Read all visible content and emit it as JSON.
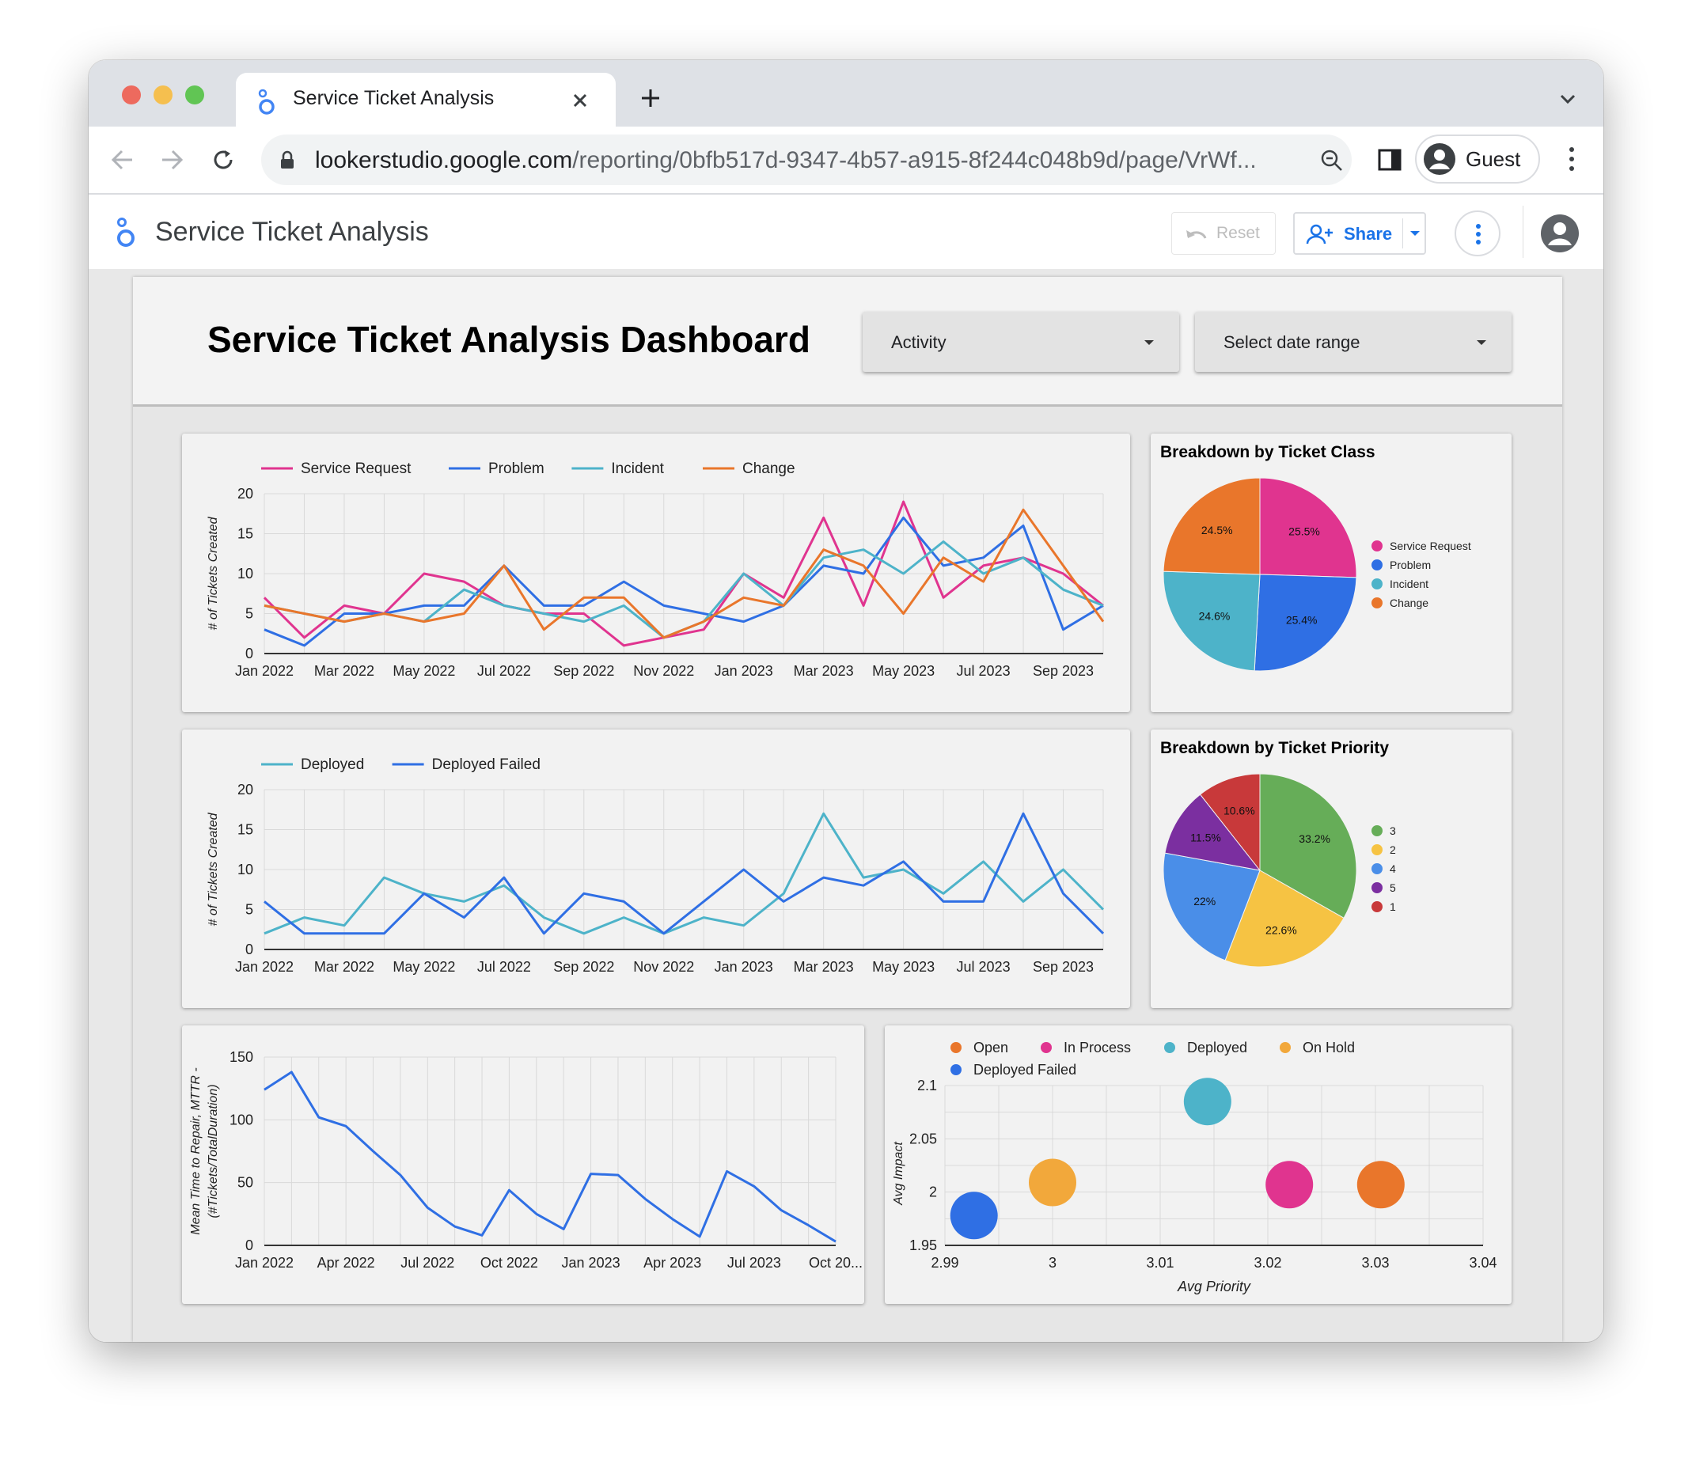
{
  "browser": {
    "tab_title": "Service Ticket Analysis",
    "url_host": "lookerstudio.google.com",
    "url_path": "/reporting/0bfb517d-9347-4b57-a915-8f244c048b9d/page/VrWf...",
    "profile_label": "Guest"
  },
  "app": {
    "title": "Service Ticket Analysis",
    "reset_label": "Reset",
    "share_label": "Share"
  },
  "dashboard": {
    "title": "Service Ticket Analysis Dashboard",
    "filter_activity": "Activity",
    "filter_date": "Select date range"
  },
  "colors": {
    "service_request": "#e0348f",
    "problem": "#2f6fe4",
    "incident": "#4db3c9",
    "change": "#e9762b",
    "priority_3": "#66ad58",
    "priority_2": "#f6c343",
    "priority_4": "#4a8ee8",
    "priority_5": "#7b2fa0",
    "priority_1": "#c8393a",
    "on_hold": "#f2a83b"
  },
  "chart_data": [
    {
      "id": "tickets_by_class",
      "type": "line",
      "title": "",
      "xlabel": "",
      "ylabel": "# of Tickets Created",
      "ylim": [
        0,
        20
      ],
      "yticks": [
        "20",
        "15",
        "10",
        "5",
        "0"
      ],
      "xticks": [
        "Jan 2022",
        "Mar 2022",
        "May 2022",
        "Jul 2022",
        "Sep 2022",
        "Nov 2022",
        "Jan 2023",
        "Mar 2023",
        "May 2023",
        "Jul 2023",
        "Sep 2023"
      ],
      "legend_position": "top",
      "x": [
        "2022-01",
        "2022-02",
        "2022-03",
        "2022-04",
        "2022-05",
        "2022-06",
        "2022-07",
        "2022-08",
        "2022-09",
        "2022-10",
        "2022-11",
        "2022-12",
        "2023-01",
        "2023-02",
        "2023-03",
        "2023-04",
        "2023-05",
        "2023-06",
        "2023-07",
        "2023-08",
        "2023-09",
        "2023-10"
      ],
      "series": [
        {
          "name": "Service Request",
          "color": "#e0348f",
          "values": [
            7,
            2,
            6,
            5,
            10,
            9,
            6,
            5,
            5,
            1,
            2,
            3,
            10,
            7,
            17,
            6,
            19,
            7,
            11,
            12,
            10,
            6
          ]
        },
        {
          "name": "Problem",
          "color": "#2f6fe4",
          "values": [
            3,
            1,
            5,
            5,
            6,
            6,
            11,
            6,
            6,
            9,
            6,
            5,
            4,
            6,
            11,
            10,
            17,
            11,
            12,
            16,
            3,
            6
          ]
        },
        {
          "name": "Incident",
          "color": "#4db3c9",
          "values": [
            6,
            5,
            4,
            5,
            4,
            8,
            6,
            5,
            4,
            6,
            2,
            4,
            10,
            6,
            12,
            13,
            10,
            14,
            10,
            12,
            8,
            6
          ]
        },
        {
          "name": "Change",
          "color": "#e9762b",
          "values": [
            6,
            5,
            4,
            5,
            4,
            5,
            11,
            3,
            7,
            7,
            2,
            4,
            7,
            6,
            13,
            11,
            5,
            12,
            9,
            18,
            11,
            4
          ]
        }
      ]
    },
    {
      "id": "deployments",
      "type": "line",
      "title": "",
      "xlabel": "",
      "ylabel": "# of Tickets Created",
      "ylim": [
        0,
        20
      ],
      "yticks": [
        "20",
        "15",
        "10",
        "5",
        "0"
      ],
      "xticks": [
        "Jan 2022",
        "Mar 2022",
        "May 2022",
        "Jul 2022",
        "Sep 2022",
        "Nov 2022",
        "Jan 2023",
        "Mar 2023",
        "May 2023",
        "Jul 2023",
        "Sep 2023"
      ],
      "legend_position": "top",
      "x": [
        "2022-01",
        "2022-02",
        "2022-03",
        "2022-04",
        "2022-05",
        "2022-06",
        "2022-07",
        "2022-08",
        "2022-09",
        "2022-10",
        "2022-11",
        "2022-12",
        "2023-01",
        "2023-02",
        "2023-03",
        "2023-04",
        "2023-05",
        "2023-06",
        "2023-07",
        "2023-08",
        "2023-09",
        "2023-10"
      ],
      "series": [
        {
          "name": "Deployed",
          "color": "#4db3c9",
          "values": [
            2,
            4,
            3,
            9,
            7,
            6,
            8,
            4,
            2,
            4,
            2,
            4,
            3,
            7,
            17,
            9,
            10,
            7,
            11,
            6,
            10,
            5
          ]
        },
        {
          "name": "Deployed Failed",
          "color": "#2f6fe4",
          "values": [
            6,
            2,
            2,
            2,
            7,
            4,
            9,
            2,
            7,
            6,
            2,
            6,
            10,
            6,
            9,
            8,
            11,
            6,
            6,
            17,
            7,
            2
          ]
        }
      ]
    },
    {
      "id": "mttr",
      "type": "line",
      "title": "",
      "xlabel": "",
      "ylabel_lines": [
        "Mean Time to Repair, MTTR -",
        "(#Tickets/TotalDuration)"
      ],
      "ylim": [
        0,
        150
      ],
      "yticks": [
        "150",
        "100",
        "50",
        "0"
      ],
      "xticks": [
        "Jan 2022",
        "Apr 2022",
        "Jul 2022",
        "Oct 2022",
        "Jan 2023",
        "Apr 2023",
        "Jul 2023",
        "Oct 20..."
      ],
      "x": [
        "2022-01",
        "2022-02",
        "2022-03",
        "2022-04",
        "2022-05",
        "2022-06",
        "2022-07",
        "2022-08",
        "2022-09",
        "2022-10",
        "2022-11",
        "2022-12",
        "2023-01",
        "2023-02",
        "2023-03",
        "2023-04",
        "2023-05",
        "2023-06",
        "2023-07",
        "2023-08",
        "2023-09",
        "2023-10"
      ],
      "series": [
        {
          "name": "",
          "color": "#2f6fe4",
          "values": [
            124,
            138,
            102,
            95,
            75,
            56,
            30,
            15,
            8,
            44,
            25,
            13,
            57,
            56,
            37,
            21,
            7,
            59,
            47,
            28,
            16,
            3
          ]
        }
      ]
    },
    {
      "id": "priority_impact",
      "type": "scatter",
      "title": "",
      "xlabel": "Avg Priority",
      "ylabel": "Avg Impact",
      "xlim": [
        2.99,
        3.04
      ],
      "ylim": [
        1.95,
        2.1
      ],
      "xticks": [
        "2.99",
        "3",
        "3.01",
        "3.02",
        "3.03",
        "3.04"
      ],
      "yticks": [
        "2.1",
        "2.05",
        "2",
        "1.95"
      ],
      "legend_position": "top",
      "series": [
        {
          "name": "Open",
          "color": "#e9762b",
          "x": 3.0305,
          "y": 2.007
        },
        {
          "name": "In Process",
          "color": "#e0348f",
          "x": 3.022,
          "y": 2.007
        },
        {
          "name": "Deployed",
          "color": "#4db3c9",
          "x": 3.0144,
          "y": 2.085
        },
        {
          "name": "On Hold",
          "color": "#f2a83b",
          "x": 3.0,
          "y": 2.009
        },
        {
          "name": "Deployed Failed",
          "color": "#2f6fe4",
          "x": 2.9927,
          "y": 1.978
        }
      ]
    },
    {
      "id": "ticket_class",
      "type": "pie",
      "title": "Breakdown by Ticket Class",
      "legend_position": "right",
      "slices": [
        {
          "label": "Service Request",
          "value": 25.5,
          "display": "25.5%",
          "color": "#e0348f"
        },
        {
          "label": "Problem",
          "value": 25.4,
          "display": "25.4%",
          "color": "#2f6fe4"
        },
        {
          "label": "Incident",
          "value": 24.6,
          "display": "24.6%",
          "color": "#4db3c9"
        },
        {
          "label": "Change",
          "value": 24.5,
          "display": "24.5%",
          "color": "#e9762b"
        }
      ]
    },
    {
      "id": "ticket_priority",
      "type": "pie",
      "title": "Breakdown by Ticket Priority",
      "legend_position": "right",
      "slices": [
        {
          "label": "3",
          "value": 33.2,
          "display": "33.2%",
          "color": "#66ad58"
        },
        {
          "label": "2",
          "value": 22.6,
          "display": "22.6%",
          "color": "#f6c343"
        },
        {
          "label": "4",
          "value": 22.0,
          "display": "22%",
          "color": "#4a8ee8"
        },
        {
          "label": "5",
          "value": 11.5,
          "display": "11.5%",
          "color": "#7b2fa0"
        },
        {
          "label": "1",
          "value": 10.6,
          "display": "10.6%",
          "color": "#c8393a"
        }
      ]
    }
  ]
}
